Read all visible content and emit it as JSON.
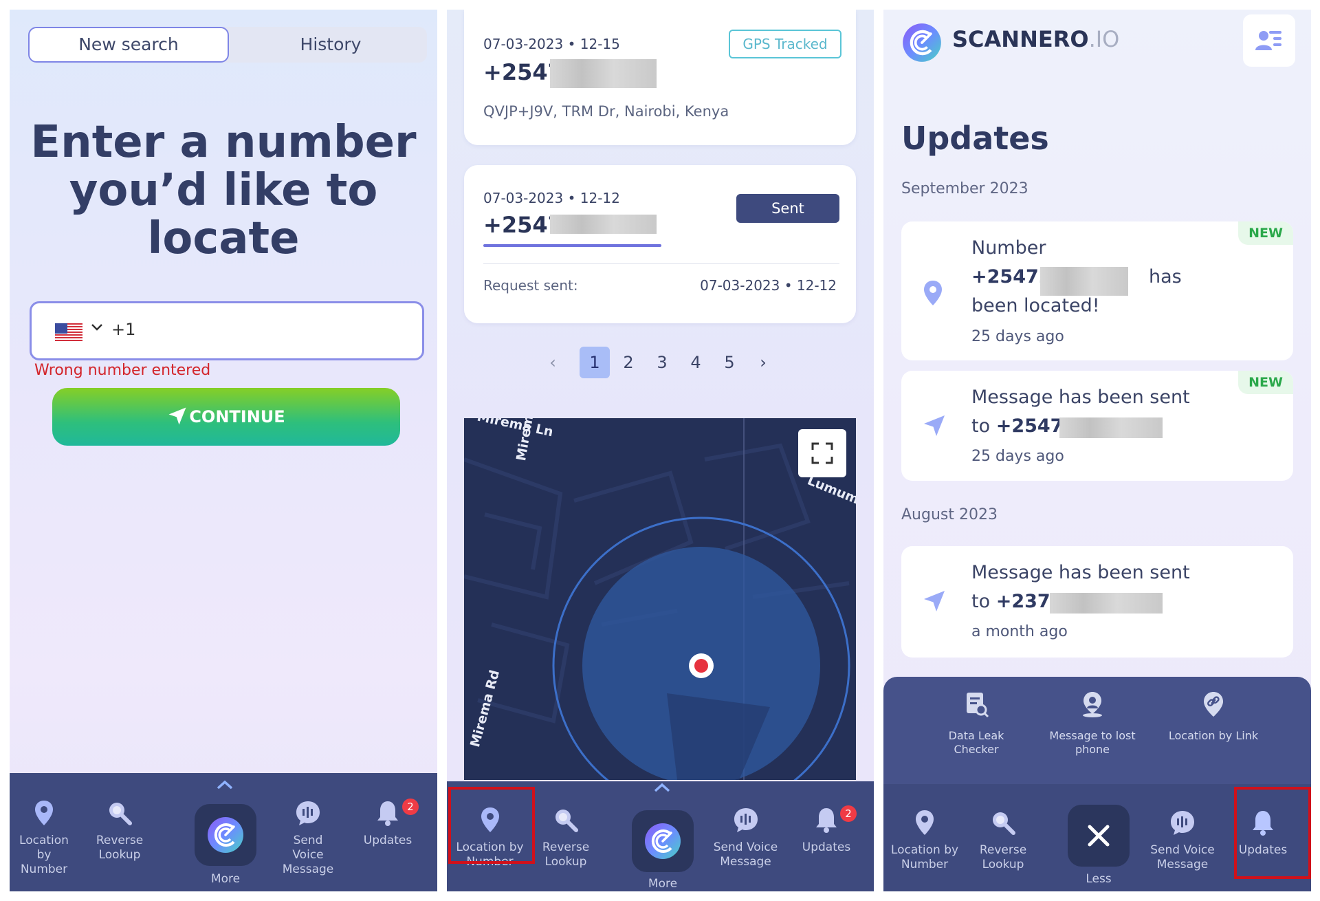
{
  "panel1": {
    "tabs": {
      "new_search": "New search",
      "history": "History"
    },
    "headline": "Enter a number you’d like to locate",
    "phone": {
      "country_code": "+1",
      "flag": "us-flag"
    },
    "error": "Wrong number entered",
    "continue_label": "CONTINUE"
  },
  "panel2": {
    "card1": {
      "datetime": "07-03-2023 • 12-15",
      "number": "+2547",
      "badge": "GPS Tracked",
      "address": "QVJP+J9V, TRM Dr, Nairobi, Kenya"
    },
    "card2": {
      "datetime": "07-03-2023 • 12-12",
      "number": "+2547",
      "badge": "Sent",
      "request_label": "Request sent:",
      "request_value": "07-03-2023 • 12-12",
      "progress": 0.5
    },
    "pagination": {
      "prev": "‹",
      "pages": [
        "1",
        "2",
        "3",
        "4",
        "5"
      ],
      "active": "1",
      "next": "›"
    },
    "map": {
      "labels": [
        "Mirema Ln",
        "Mirema Rd",
        "Lumumb",
        "Mirema Rd"
      ]
    }
  },
  "panel3": {
    "brand": {
      "name": "SCANNERO",
      "suffix": ".IO"
    },
    "title": "Updates",
    "sections": [
      {
        "month": "September 2023"
      },
      {
        "month": "August 2023"
      }
    ],
    "updates": [
      {
        "tag": "NEW",
        "line1": "Number",
        "number": "+25472",
        "after": "has",
        "line3": "been located!",
        "time": "25 days ago",
        "icon": "location-pin-icon"
      },
      {
        "tag": "NEW",
        "line1": "Message has been sent",
        "prefix": "to",
        "number": "+25472",
        "time": "25 days ago",
        "icon": "send-icon"
      },
      {
        "tag": "",
        "line1": "Message has been sent",
        "prefix": "to",
        "number": "+2376",
        "time": "a month ago",
        "icon": "send-icon"
      }
    ],
    "more_items": [
      {
        "label": "Data Leak Checker",
        "icon": "data-leak-icon"
      },
      {
        "label": "Message to lost phone",
        "icon": "lost-phone-icon"
      },
      {
        "label": "Location by Link",
        "icon": "link-location-icon"
      }
    ],
    "less_label": "Less"
  },
  "nav": {
    "location": "Location by Number",
    "reverse": "Reverse Lookup",
    "more": "More",
    "voice": "Send Voice Message",
    "updates": "Updates",
    "badge": "2"
  },
  "colors": {
    "nav_bg": "#3e4a7e",
    "accent": "#7e85e6",
    "error": "#d3252b",
    "highlight": "#d0111b"
  }
}
